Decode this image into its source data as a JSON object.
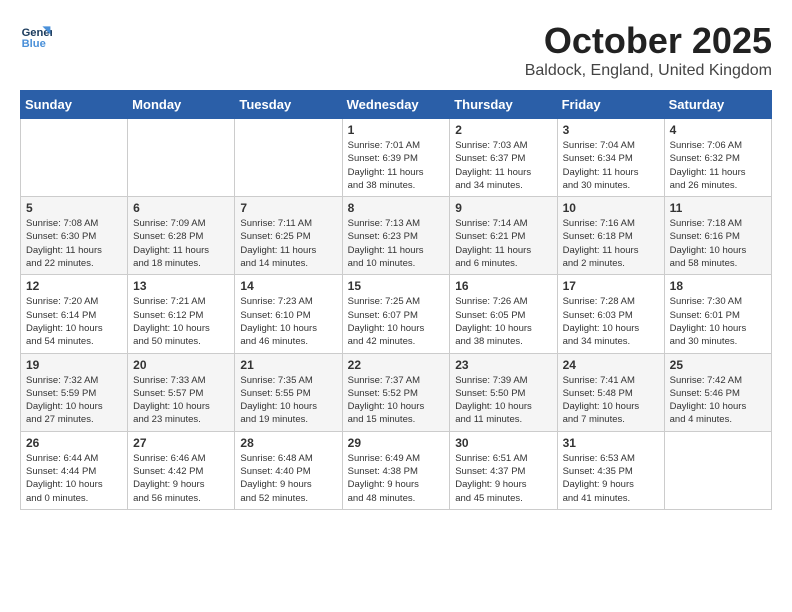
{
  "logo": {
    "line1": "General",
    "line2": "Blue"
  },
  "title": "October 2025",
  "location": "Baldock, England, United Kingdom",
  "weekdays": [
    "Sunday",
    "Monday",
    "Tuesday",
    "Wednesday",
    "Thursday",
    "Friday",
    "Saturday"
  ],
  "weeks": [
    [
      {
        "day": "",
        "info": ""
      },
      {
        "day": "",
        "info": ""
      },
      {
        "day": "",
        "info": ""
      },
      {
        "day": "1",
        "info": "Sunrise: 7:01 AM\nSunset: 6:39 PM\nDaylight: 11 hours\nand 38 minutes."
      },
      {
        "day": "2",
        "info": "Sunrise: 7:03 AM\nSunset: 6:37 PM\nDaylight: 11 hours\nand 34 minutes."
      },
      {
        "day": "3",
        "info": "Sunrise: 7:04 AM\nSunset: 6:34 PM\nDaylight: 11 hours\nand 30 minutes."
      },
      {
        "day": "4",
        "info": "Sunrise: 7:06 AM\nSunset: 6:32 PM\nDaylight: 11 hours\nand 26 minutes."
      }
    ],
    [
      {
        "day": "5",
        "info": "Sunrise: 7:08 AM\nSunset: 6:30 PM\nDaylight: 11 hours\nand 22 minutes."
      },
      {
        "day": "6",
        "info": "Sunrise: 7:09 AM\nSunset: 6:28 PM\nDaylight: 11 hours\nand 18 minutes."
      },
      {
        "day": "7",
        "info": "Sunrise: 7:11 AM\nSunset: 6:25 PM\nDaylight: 11 hours\nand 14 minutes."
      },
      {
        "day": "8",
        "info": "Sunrise: 7:13 AM\nSunset: 6:23 PM\nDaylight: 11 hours\nand 10 minutes."
      },
      {
        "day": "9",
        "info": "Sunrise: 7:14 AM\nSunset: 6:21 PM\nDaylight: 11 hours\nand 6 minutes."
      },
      {
        "day": "10",
        "info": "Sunrise: 7:16 AM\nSunset: 6:18 PM\nDaylight: 11 hours\nand 2 minutes."
      },
      {
        "day": "11",
        "info": "Sunrise: 7:18 AM\nSunset: 6:16 PM\nDaylight: 10 hours\nand 58 minutes."
      }
    ],
    [
      {
        "day": "12",
        "info": "Sunrise: 7:20 AM\nSunset: 6:14 PM\nDaylight: 10 hours\nand 54 minutes."
      },
      {
        "day": "13",
        "info": "Sunrise: 7:21 AM\nSunset: 6:12 PM\nDaylight: 10 hours\nand 50 minutes."
      },
      {
        "day": "14",
        "info": "Sunrise: 7:23 AM\nSunset: 6:10 PM\nDaylight: 10 hours\nand 46 minutes."
      },
      {
        "day": "15",
        "info": "Sunrise: 7:25 AM\nSunset: 6:07 PM\nDaylight: 10 hours\nand 42 minutes."
      },
      {
        "day": "16",
        "info": "Sunrise: 7:26 AM\nSunset: 6:05 PM\nDaylight: 10 hours\nand 38 minutes."
      },
      {
        "day": "17",
        "info": "Sunrise: 7:28 AM\nSunset: 6:03 PM\nDaylight: 10 hours\nand 34 minutes."
      },
      {
        "day": "18",
        "info": "Sunrise: 7:30 AM\nSunset: 6:01 PM\nDaylight: 10 hours\nand 30 minutes."
      }
    ],
    [
      {
        "day": "19",
        "info": "Sunrise: 7:32 AM\nSunset: 5:59 PM\nDaylight: 10 hours\nand 27 minutes."
      },
      {
        "day": "20",
        "info": "Sunrise: 7:33 AM\nSunset: 5:57 PM\nDaylight: 10 hours\nand 23 minutes."
      },
      {
        "day": "21",
        "info": "Sunrise: 7:35 AM\nSunset: 5:55 PM\nDaylight: 10 hours\nand 19 minutes."
      },
      {
        "day": "22",
        "info": "Sunrise: 7:37 AM\nSunset: 5:52 PM\nDaylight: 10 hours\nand 15 minutes."
      },
      {
        "day": "23",
        "info": "Sunrise: 7:39 AM\nSunset: 5:50 PM\nDaylight: 10 hours\nand 11 minutes."
      },
      {
        "day": "24",
        "info": "Sunrise: 7:41 AM\nSunset: 5:48 PM\nDaylight: 10 hours\nand 7 minutes."
      },
      {
        "day": "25",
        "info": "Sunrise: 7:42 AM\nSunset: 5:46 PM\nDaylight: 10 hours\nand 4 minutes."
      }
    ],
    [
      {
        "day": "26",
        "info": "Sunrise: 6:44 AM\nSunset: 4:44 PM\nDaylight: 10 hours\nand 0 minutes."
      },
      {
        "day": "27",
        "info": "Sunrise: 6:46 AM\nSunset: 4:42 PM\nDaylight: 9 hours\nand 56 minutes."
      },
      {
        "day": "28",
        "info": "Sunrise: 6:48 AM\nSunset: 4:40 PM\nDaylight: 9 hours\nand 52 minutes."
      },
      {
        "day": "29",
        "info": "Sunrise: 6:49 AM\nSunset: 4:38 PM\nDaylight: 9 hours\nand 48 minutes."
      },
      {
        "day": "30",
        "info": "Sunrise: 6:51 AM\nSunset: 4:37 PM\nDaylight: 9 hours\nand 45 minutes."
      },
      {
        "day": "31",
        "info": "Sunrise: 6:53 AM\nSunset: 4:35 PM\nDaylight: 9 hours\nand 41 minutes."
      },
      {
        "day": "",
        "info": ""
      }
    ]
  ]
}
